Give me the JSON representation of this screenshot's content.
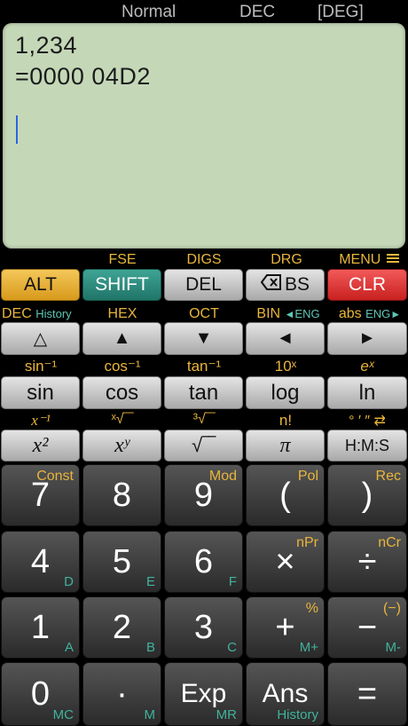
{
  "status": {
    "mode": "Normal",
    "base": "DEC",
    "angle": "[DEG]"
  },
  "display": {
    "line1": "1,234",
    "line2": "=0000 04D2"
  },
  "row1_labels": [
    "FSE",
    "DIGS",
    "DRG",
    "MENU"
  ],
  "row1": [
    "ALT",
    "SHIFT",
    "DEL",
    "BS",
    "CLR"
  ],
  "row2_labels": {
    "dec": "DEC",
    "history": "History",
    "hex": "HEX",
    "oct": "OCT",
    "bin": "BIN",
    "eng1": "ENG",
    "abs": "abs",
    "eng2": "ENG"
  },
  "row2": [
    "△",
    "▲",
    "▼",
    "◄",
    "►"
  ],
  "row3_labels": [
    "sin⁻¹",
    "cos⁻¹",
    "tan⁻¹",
    "10ˣ",
    "eˣ"
  ],
  "row3": [
    "sin",
    "cos",
    "tan",
    "log",
    "ln"
  ],
  "row4_labels": [
    "x⁻¹",
    "ˣ√‾‾",
    "³√‾‾",
    "n!",
    "° ′ ″ ⇄"
  ],
  "row4": [
    "x²",
    "xʸ",
    "√‾‾",
    "π",
    "H:M:S"
  ],
  "keypad": [
    {
      "main": "7",
      "top": "Const",
      "bottom": ""
    },
    {
      "main": "8",
      "top": "",
      "bottom": ""
    },
    {
      "main": "9",
      "top": "Mod",
      "bottom": ""
    },
    {
      "main": "(",
      "top": "Pol",
      "bottom": ""
    },
    {
      "main": ")",
      "top": "Rec",
      "bottom": ""
    },
    {
      "main": "4",
      "top": "",
      "bottom": "D"
    },
    {
      "main": "5",
      "top": "",
      "bottom": "E"
    },
    {
      "main": "6",
      "top": "",
      "bottom": "F"
    },
    {
      "main": "×",
      "top": "nPr",
      "bottom": ""
    },
    {
      "main": "÷",
      "top": "nCr",
      "bottom": ""
    },
    {
      "main": "1",
      "top": "",
      "bottom": "A"
    },
    {
      "main": "2",
      "top": "",
      "bottom": "B"
    },
    {
      "main": "3",
      "top": "",
      "bottom": "C"
    },
    {
      "main": "+",
      "top": "%",
      "bottom": "M+"
    },
    {
      "main": "−",
      "top": "(−)",
      "bottom": "M-"
    },
    {
      "main": "0",
      "top": "",
      "bottom": "MC"
    },
    {
      "main": "·",
      "top": "",
      "bottom": "M"
    },
    {
      "main": "Exp",
      "top": "",
      "bottom": "MR"
    },
    {
      "main": "Ans",
      "top": "",
      "bottom": "History"
    },
    {
      "main": "=",
      "top": "",
      "bottom": ""
    }
  ]
}
